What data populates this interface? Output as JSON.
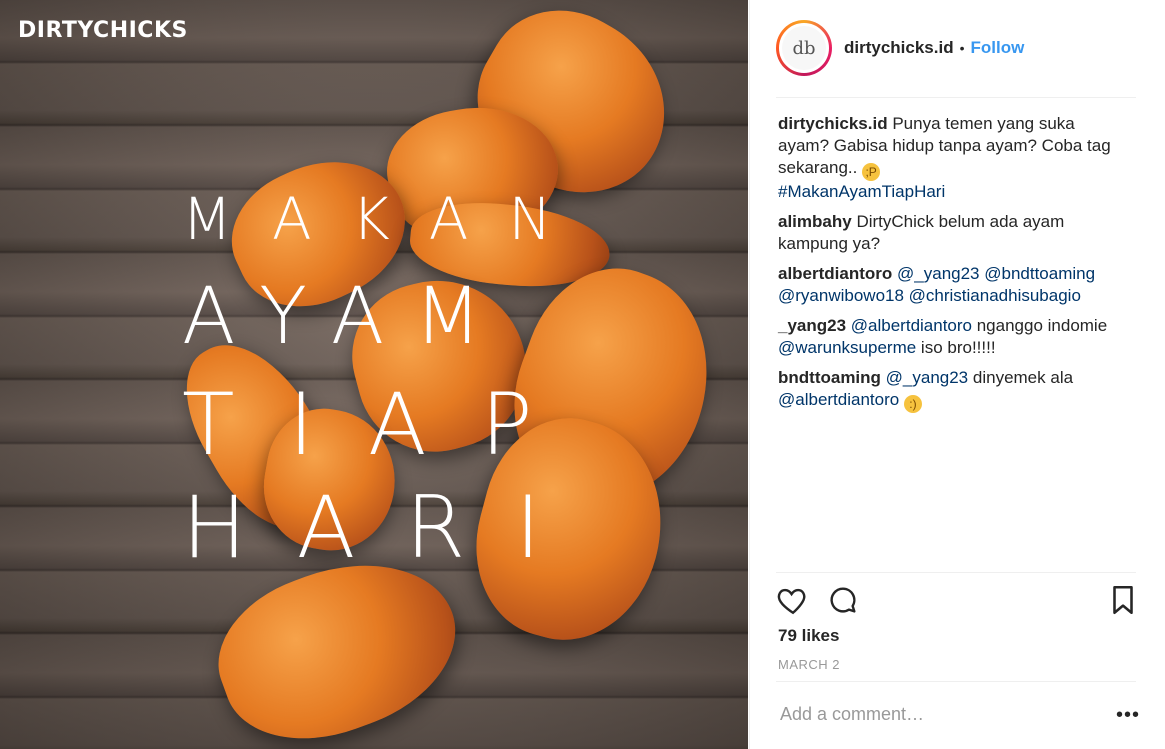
{
  "photo": {
    "brand": "DIRTYCHICKS",
    "lines": [
      "MAKAN",
      "AYAM",
      "TIAP",
      "HARI"
    ]
  },
  "header": {
    "avatar_text": "db",
    "username": "dirtychicks.id",
    "dot": "•",
    "follow_label": "Follow"
  },
  "comments": [
    {
      "user": "dirtychicks.id",
      "text": "Punya temen yang suka ayam? Gabisa hidup tanpa ayam? Coba tag sekarang.. ",
      "emoji": "😜",
      "hashtag": "#MakanAyamTiapHari"
    },
    {
      "user": "alimbahy",
      "text": "DirtyChick belum ada ayam kampung ya?"
    },
    {
      "user": "albertdiantoro",
      "mentions": "@_yang23 @bndttoaming @ryanwibowo18 @christianadhisubagio"
    },
    {
      "user": "_yang23",
      "mention1": "@albertdiantoro",
      "text1": " nganggo indomie ",
      "mention2": "@warunksuperme",
      "text2": " iso bro!!!!!"
    },
    {
      "user": "bndttoaming",
      "mention1": "@_yang23",
      "text1": " dinyemek ala ",
      "mention2": "@albertdiantoro",
      "emoji": "😏"
    }
  ],
  "icons": {
    "like": "heart-icon",
    "comment": "comment-icon",
    "save": "bookmark-icon",
    "more": "more-options-icon"
  },
  "likes": "79 likes",
  "date": "MARCH 2",
  "add_comment_placeholder": "Add a comment…",
  "more_label": "•••"
}
